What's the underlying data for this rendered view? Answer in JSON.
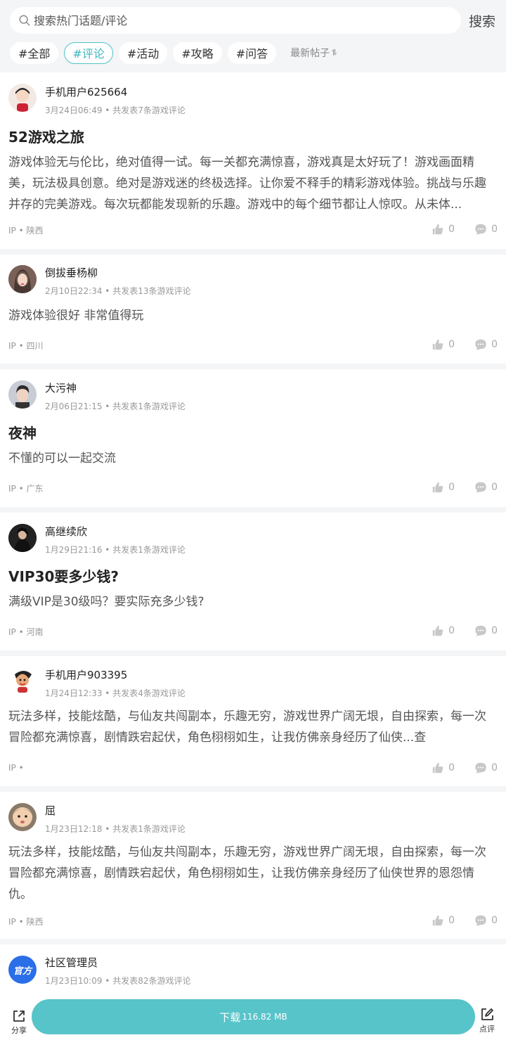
{
  "search": {
    "placeholder": "搜索热门话题/评论",
    "button": "搜索"
  },
  "tabs": [
    {
      "label": "#全部"
    },
    {
      "label": "#评论"
    },
    {
      "label": "#活动"
    },
    {
      "label": "#攻略"
    },
    {
      "label": "#问答"
    }
  ],
  "sort_label": "最新帖子",
  "sort_icon": "⥮",
  "posts": [
    {
      "user": "手机用户625664",
      "meta": "3月24日06:49 • 共发表7条游戏评论",
      "title": "52游戏之旅",
      "content": "游戏体验无与伦比，绝对值得一试。每一关都充满惊喜，游戏真是太好玩了！游戏画面精美，玩法极具创意。绝对是游戏迷的终极选择。让你爱不释手的精彩游戏体验。挑战与乐趣并存的完美游戏。每次玩都能发现新的乐趣。游戏中的每个细节都让人惊叹。从未体...",
      "ip": "IP • 陕西",
      "likes": "0",
      "comments": "0"
    },
    {
      "user": "倒拔垂杨柳",
      "meta": "2月10日22:34 • 共发表13条游戏评论",
      "title": "",
      "content": "游戏体验很好 非常值得玩",
      "ip": "IP • 四川",
      "likes": "0",
      "comments": "0"
    },
    {
      "user": "大污神",
      "meta": "2月06日21:15 • 共发表1条游戏评论",
      "title": "夜神",
      "content": "不懂的可以一起交流",
      "ip": "IP • 广东",
      "likes": "0",
      "comments": "0"
    },
    {
      "user": "高继续欣",
      "meta": "1月29日21:16 • 共发表1条游戏评论",
      "title": "VIP30要多少钱?",
      "content": "满级VIP是30级吗？要实际充多少钱?",
      "ip": "IP • 河南",
      "likes": "0",
      "comments": "0"
    },
    {
      "user": "手机用户903395",
      "meta": "1月24日12:33 • 共发表4条游戏评论",
      "title": "",
      "content": "玩法多样，技能炫酷，与仙友共闯副本，乐趣无穷，游戏世界广阔无垠，自由探索，每一次冒险都充满惊喜，剧情跌宕起伏，角色栩栩如生，让我仿佛亲身经历了仙侠...查",
      "ip": "IP •",
      "likes": "0",
      "comments": "0"
    },
    {
      "user": "屈",
      "meta": "1月23日12:18 • 共发表1条游戏评论",
      "title": "",
      "content": "玩法多样，技能炫酷，与仙友共闯副本，乐趣无穷，游戏世界广阔无垠，自由探索，每一次冒险都充满惊喜，剧情跌宕起伏，角色栩栩如生，让我仿佛亲身经历了仙侠世界的恩怨情仇。",
      "ip": "IP • 陕西",
      "likes": "0",
      "comments": "0"
    },
    {
      "user": "社区管理员",
      "meta": "1月23日10:09 • 共发表82条游戏评论",
      "badge": "官方"
    }
  ],
  "bottom": {
    "share": "分享",
    "download": "下载",
    "size": "116.82 MB",
    "review": "点评"
  },
  "colors": {
    "accent": "#57c4ca",
    "tab_active": "#3fb6bd",
    "official": "#2a6ee8"
  },
  "icons": [
    "search-icon",
    "like-icon",
    "comment-icon",
    "share-icon",
    "edit-icon"
  ]
}
